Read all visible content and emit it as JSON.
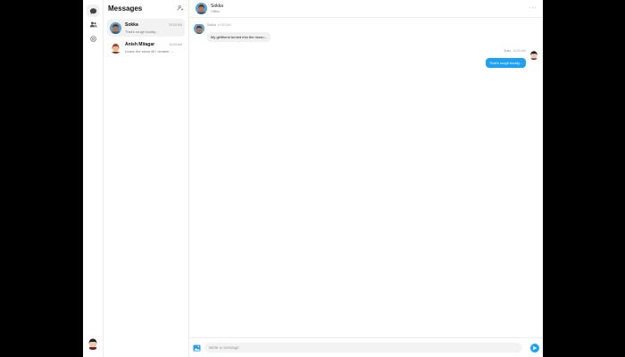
{
  "sidebar": {
    "icons": [
      "chat-icon",
      "contacts-icon",
      "settings-icon"
    ]
  },
  "list": {
    "title": "Messages",
    "conversations": [
      {
        "name": "Sokka",
        "time": "10:53 AM",
        "preview": "That's rough buddy..."
      },
      {
        "name": "Anish Mitagar",
        "time": "10:53 AM",
        "preview": "Leave the stove till I reclaim ..."
      }
    ]
  },
  "chat": {
    "name": "Sokka",
    "status": "Offline",
    "incoming": {
      "sender": "Sokka",
      "time": "10:53 AM",
      "text": "My girlfriend turned into the moon..."
    },
    "outgoing": {
      "sender": "Zuko",
      "time": "10:53 AM",
      "text": "That's rough buddy..."
    }
  },
  "composer": {
    "placeholder": "Write a message"
  },
  "colors": {
    "accent": "#1da1f2"
  }
}
